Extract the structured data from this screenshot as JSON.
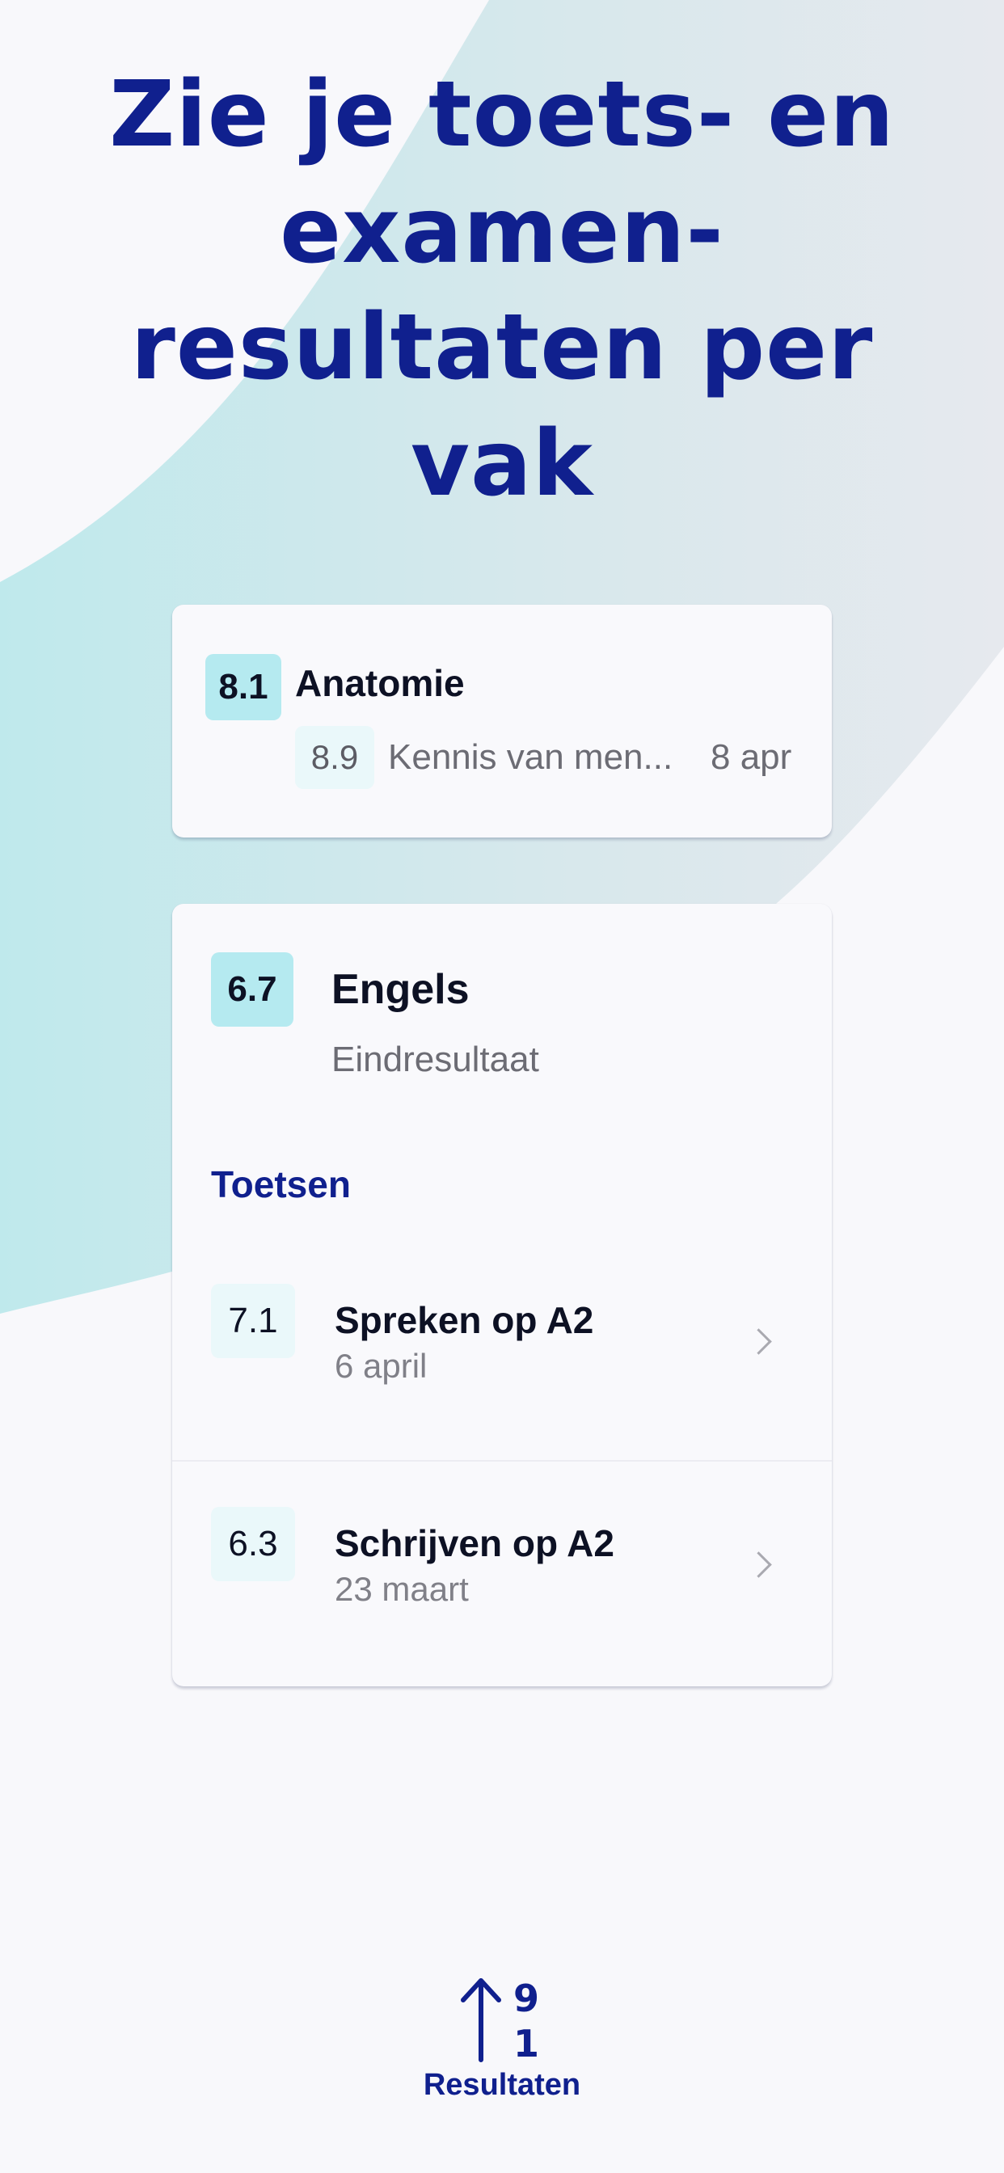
{
  "headline": "Zie je toets- en examen-resultaten per vak",
  "colors": {
    "accent": "#10208e",
    "grade_bg": "#b5eaf0",
    "grade_sub_bg": "#eaf8fa",
    "background": "#f8f8fb"
  },
  "cards": [
    {
      "grade": "8.1",
      "subject": "Anatomie",
      "items": [
        {
          "grade": "8.9",
          "title": "Kennis van men...",
          "date": "8 apr"
        }
      ]
    },
    {
      "grade": "6.7",
      "subject": "Engels",
      "subtitle": "Eindresultaat",
      "section_label": "Toetsen",
      "tests": [
        {
          "grade": "7.1",
          "title": "Spreken op A2",
          "date": "6 april",
          "icon": "chevron-right-icon"
        },
        {
          "grade": "6.3",
          "title": "Schrijven op A2",
          "date": "23 maart",
          "icon": "chevron-right-icon"
        }
      ]
    }
  ],
  "tabbar": {
    "label": "Resultaten",
    "icon": "sort-results-icon",
    "icon_digits": [
      "9",
      "1"
    ]
  }
}
